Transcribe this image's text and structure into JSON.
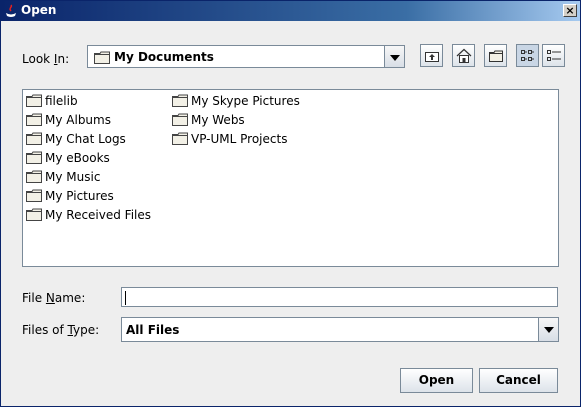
{
  "window": {
    "title": "Open",
    "close_symbol": "×"
  },
  "look_in": {
    "label_pre": "Look ",
    "label_mnemonic": "I",
    "label_post": "n:",
    "selected": "My Documents"
  },
  "toolbar": {
    "buttons": [
      {
        "icon": "up-one-level-icon"
      },
      {
        "icon": "home-icon"
      },
      {
        "icon": "new-folder-icon"
      },
      {
        "icon": "list-view-icon",
        "pressed": true
      },
      {
        "icon": "details-view-icon"
      }
    ]
  },
  "files": [
    {
      "name": "filelib"
    },
    {
      "name": "My Albums"
    },
    {
      "name": "My Chat Logs"
    },
    {
      "name": "My eBooks"
    },
    {
      "name": "My Music"
    },
    {
      "name": "My Pictures"
    },
    {
      "name": "My Received Files"
    },
    {
      "name": "My Skype Pictures"
    },
    {
      "name": "My Webs"
    },
    {
      "name": "VP-UML Projects"
    }
  ],
  "file_name": {
    "label_pre": "File ",
    "label_mnemonic": "N",
    "label_post": "ame:",
    "value": ""
  },
  "file_type": {
    "label_pre": "Files of ",
    "label_mnemonic": "T",
    "label_post": "ype:",
    "selected": "All Files"
  },
  "buttons": {
    "open": "Open",
    "cancel": "Cancel"
  },
  "colors": {
    "title_start": "#0a246a",
    "title_end": "#a6caf0",
    "folder": "#f2f0e6",
    "border": "#7a8a99"
  }
}
